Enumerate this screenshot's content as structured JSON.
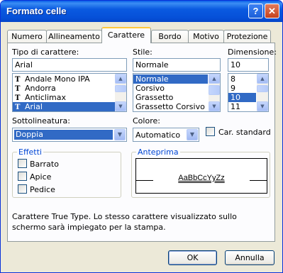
{
  "window": {
    "title": "Formato celle",
    "help_label": "?",
    "close_label": "✕"
  },
  "tabs": [
    "Numero",
    "Allineamento",
    "Carattere",
    "Bordo",
    "Motivo",
    "Protezione"
  ],
  "font": {
    "label": "Tipo di carattere:",
    "value": "Arial",
    "items": [
      "Andale Mono IPA",
      "Andorra",
      "Anticlimax",
      "Arial"
    ],
    "selected_index": 3,
    "truetype_glyph": "T"
  },
  "style": {
    "label": "Stile:",
    "value": "Normale",
    "items": [
      "Normale",
      "Corsivo",
      "Grassetto",
      "Grassetto Corsivo"
    ],
    "selected_index": 0
  },
  "size": {
    "label": "Dimensione:",
    "value": "10",
    "items": [
      "8",
      "9",
      "10",
      "11"
    ],
    "selected_index": 2
  },
  "underline": {
    "label": "Sottolineatura:",
    "value": "Doppia"
  },
  "color": {
    "label": "Colore:",
    "value": "Automatico",
    "standard_label": "Car. standard"
  },
  "effects": {
    "title": "Effetti",
    "items": [
      "Barrato",
      "Apice",
      "Pedice"
    ]
  },
  "preview": {
    "title": "Anteprima",
    "sample": "AaBbCcYyZz"
  },
  "info_text": "Carattere True Type. Lo stesso carattere visualizzato sullo schermo sarà impiegato per la stampa.",
  "buttons": {
    "ok": "OK",
    "cancel": "Annulla"
  },
  "icons": {
    "scroll_up": "scroll-up-arrow",
    "scroll_down": "scroll-down-arrow",
    "dropdown": "chevron-down"
  }
}
